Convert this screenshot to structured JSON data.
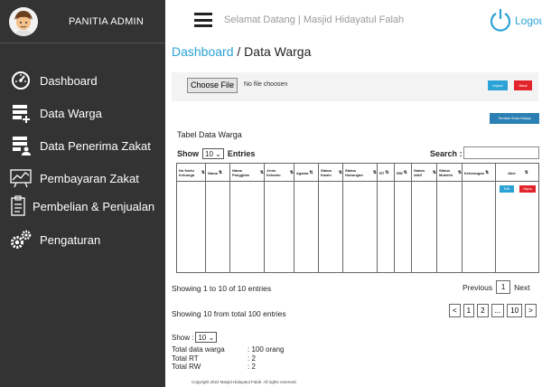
{
  "sidebar": {
    "title": "PANITIA ADMIN",
    "items": [
      {
        "label": "Dashboard",
        "icon": "dashboard-gauge-icon"
      },
      {
        "label": "Data Warga",
        "icon": "list-add-icon"
      },
      {
        "label": "Data Penerima Zakat",
        "icon": "user-list-icon"
      },
      {
        "label": "Pembayaran Zakat",
        "icon": "payment-chart-icon"
      },
      {
        "label": "Pembelian & Penjualan",
        "icon": "clipboard-icon"
      },
      {
        "label": "Pengaturan",
        "icon": "gears-icon"
      }
    ]
  },
  "topbar": {
    "welcome": "Selamat Datang | Masjid Hidayatul Falah",
    "logout": "Logou"
  },
  "breadcrumb": {
    "link": "Dashboard",
    "sep": " / ",
    "current": "Data Warga"
  },
  "import": {
    "choose_label": "Choose File",
    "no_file": "No file choosen",
    "import_label": "Import",
    "batal_label": "Batal"
  },
  "tambah_label": "Tambah Data Warga",
  "table": {
    "title": "Tabel Data Warga",
    "show_label": "Show",
    "show_value": "10",
    "entries_label": "Entries",
    "search_label": "Search :",
    "headers": [
      "No Kartu Keluarga",
      "Nama",
      "Nama Panggilan",
      "Jenis Kelamin",
      "Agama",
      "Status Kawin",
      "Status Hubungan",
      "RT",
      "RW",
      "Status Aktif",
      "Status Mukmin",
      "Keterangan",
      "Aksi"
    ],
    "edit_label": "Edit",
    "hapus_label": "Hapus"
  },
  "footer_a": {
    "showing": "Showing 1 to 10 of 10 entries",
    "previous": "Previous",
    "page": "1",
    "next": "Next"
  },
  "footer_b": {
    "showing": "Showing 10 from total 100 entries",
    "pages": [
      "<",
      "1",
      "2",
      "...",
      "10",
      ">"
    ]
  },
  "show_b": {
    "label": "Show :",
    "value": "10"
  },
  "stats": [
    {
      "key": "Total data warga",
      "value": ": 100 orang"
    },
    {
      "key": "Total RT",
      "value": ": 2"
    },
    {
      "key": "Total RW",
      "value": ": 2"
    }
  ],
  "copyright": "Copyright     2022 Masjid Hidayatul Falah. All rights reserved.",
  "colors": {
    "sidebar": "#333333",
    "accent": "#2ba3d6",
    "danger": "#e3242b",
    "tambah": "#2b7fb2"
  }
}
